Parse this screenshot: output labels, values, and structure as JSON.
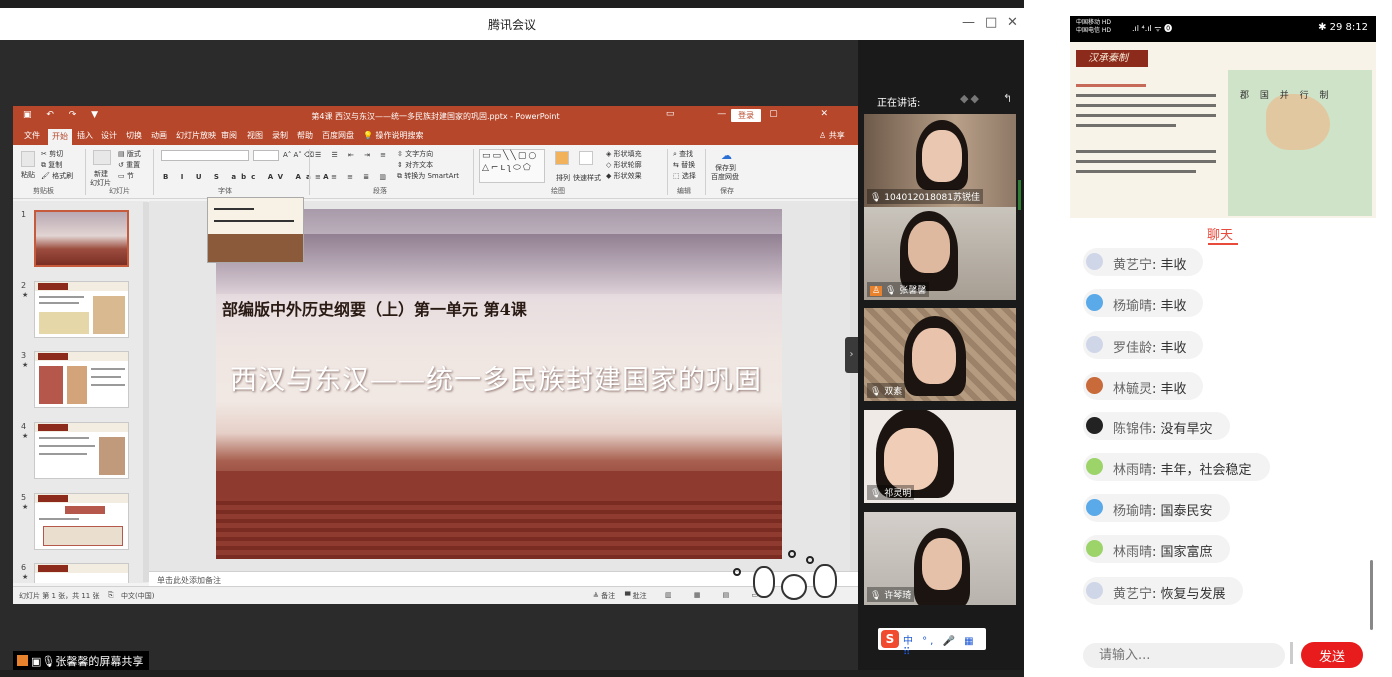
{
  "window": {
    "title": "腾讯会议",
    "controls": {
      "minimize": "—",
      "maximize": "□",
      "close": "✕"
    }
  },
  "ppt": {
    "title": "第4课 西汉与东汉——统一多民族封建国家的巩固.pptx - PowerPoint",
    "login": "登录",
    "share": "共享",
    "tabs": [
      "文件",
      "开始",
      "插入",
      "设计",
      "切换",
      "动画",
      "幻灯片放映",
      "审阅",
      "视图",
      "录制",
      "帮助",
      "百度网盘",
      "操作说明搜索"
    ],
    "ribbon": {
      "clipboard": {
        "paste": "粘贴",
        "cut": "剪切",
        "copy": "复制",
        "format_painter": "格式刷",
        "label": "剪贴板"
      },
      "slides": {
        "new": "新建",
        "new2": "幻灯片",
        "layout": "版式",
        "reset": "重置",
        "section": "节",
        "label": "幻灯片"
      },
      "font": {
        "label": "字体"
      },
      "paragraph": {
        "text_dir": "文字方向",
        "align_text": "对齐文本",
        "smartart": "转换为 SmartArt",
        "label": "段落"
      },
      "drawing": {
        "arrange": "排列",
        "quick_styles": "快速样式",
        "fill": "形状填充",
        "outline": "形状轮廓",
        "effects": "形状效果",
        "label": "绘图"
      },
      "editing": {
        "find": "查找",
        "replace": "替换",
        "select": "选择",
        "label": "编辑"
      },
      "save": {
        "label1": "保存到",
        "label2": "百度网盘",
        "label": "保存"
      }
    },
    "thumbnails": [
      {
        "num": "1",
        "star": ""
      },
      {
        "num": "2",
        "star": "★"
      },
      {
        "num": "3",
        "star": "★"
      },
      {
        "num": "4",
        "star": "★"
      },
      {
        "num": "5",
        "star": "★"
      },
      {
        "num": "6",
        "star": "★"
      }
    ],
    "slide": {
      "subtitle": "部编版中外历史纲要（上）第一单元 第4课",
      "title": "西汉与东汉——统一多民族封建国家的巩固"
    },
    "notes_placeholder": "单击此处添加备注",
    "status": {
      "slide_count": "幻灯片 第 1 张，共 11 张",
      "language": "中文(中国)",
      "notes": "备注",
      "comments": "批注"
    }
  },
  "share_label": "张馨馨的屏幕共享",
  "speaker_panel": {
    "label": "正在讲话:",
    "participants": [
      {
        "name": "104012018081苏锐佳"
      },
      {
        "name": "张馨馨"
      },
      {
        "name": "双素"
      },
      {
        "name": "祁灵明"
      },
      {
        "name": "许琴琦"
      }
    ]
  },
  "ime": {
    "brand": "S",
    "items": "中 °, 🎤 ▦ ⠿"
  },
  "phone": {
    "status": {
      "carrier1": "中国移动 HD",
      "carrier2": "中国电信 HD",
      "right": "✱ 29 8:12"
    },
    "slide_header": "汉承秦制",
    "map_title": "郡 国 并 行 制",
    "chat_tab": "聊天",
    "messages": [
      {
        "name": "黄艺宁",
        "text": "丰收",
        "avatar": "#cfd6e8"
      },
      {
        "name": "杨瑜晴",
        "text": "丰收",
        "avatar": "#5aa9e8"
      },
      {
        "name": "罗佳龄",
        "text": "丰收",
        "avatar": "#cfd6e8"
      },
      {
        "name": "林毓灵",
        "text": "丰收",
        "avatar": "#c86a3a"
      },
      {
        "name": "陈锦伟",
        "text": "没有旱灾",
        "avatar": "#222222"
      },
      {
        "name": "林雨晴",
        "text": "丰年，社会稳定",
        "avatar": "#9cd46a"
      },
      {
        "name": "杨瑜晴",
        "text": "国泰民安",
        "avatar": "#5aa9e8"
      },
      {
        "name": "林雨晴",
        "text": "国家富庶",
        "avatar": "#9cd46a"
      },
      {
        "name": "黄艺宁",
        "text": "恢复与发展",
        "avatar": "#cfd6e8"
      }
    ],
    "input_placeholder": "请输入...",
    "send_label": "发送"
  },
  "colors": {
    "ppt_accent": "#b7472a",
    "send": "#e81c1c",
    "chat_tab": "#e84b3c"
  }
}
